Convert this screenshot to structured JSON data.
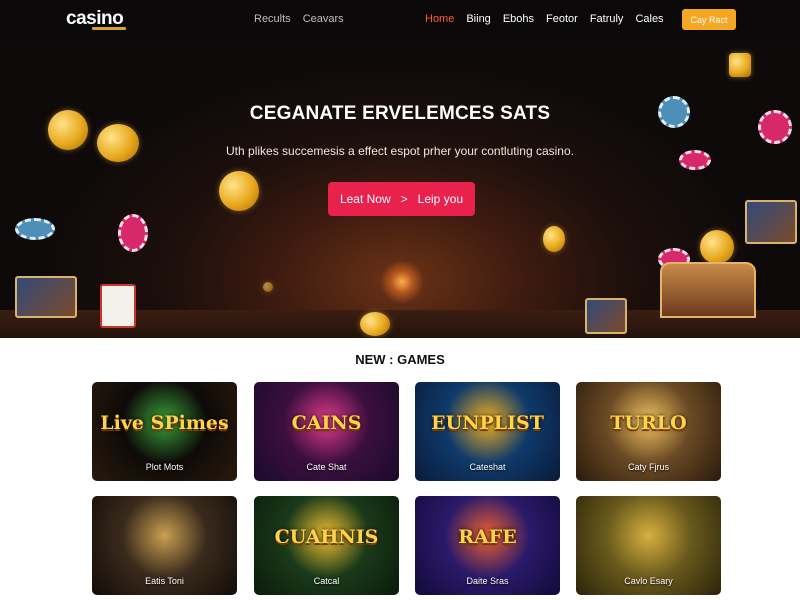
{
  "header": {
    "logo": "casino",
    "nav_left": [
      "Recults",
      "Ceavars"
    ],
    "nav_right": [
      {
        "label": "Home",
        "active": true
      },
      {
        "label": "Biing",
        "active": false
      },
      {
        "label": "Ebohs",
        "active": false
      },
      {
        "label": "Feotor",
        "active": false
      },
      {
        "label": "Fatruly",
        "active": false
      },
      {
        "label": "Cales",
        "active": false
      }
    ],
    "cta": "Cay Ract"
  },
  "hero": {
    "title": "CEGANATE ERVELEMCES SATS",
    "subtitle": "Uth plikes succemesis a effect espot prher your contluting casino.",
    "button_left": "Leat Now",
    "button_chevron": ">",
    "button_right": "Leip you"
  },
  "games": {
    "title": "NEW : GAMES",
    "tiles": [
      {
        "art": "Live SPimes",
        "label": "Plot Mots",
        "bg": [
          "#0e0a08",
          "#2a1a0c"
        ],
        "accent": "#3aa13a"
      },
      {
        "art": "CAINS",
        "label": "Cate Shat",
        "bg": [
          "#3b0f3f",
          "#1a0a2a"
        ],
        "accent": "#e23a8a"
      },
      {
        "art": "EUNPLIST",
        "label": "Cateshat",
        "bg": [
          "#0f3a6a",
          "#0a1a3a"
        ],
        "accent": "#f0b020"
      },
      {
        "art": "TURLO",
        "label": "Caty Fjrus",
        "bg": [
          "#6a4a24",
          "#2a1a0c"
        ],
        "accent": "#f0c060"
      },
      {
        "art": "",
        "label": "Eatis Toni",
        "bg": [
          "#3a2a1c",
          "#120c08"
        ],
        "accent": "#c8a050"
      },
      {
        "art": "CUAHNIS",
        "label": "Catcal",
        "bg": [
          "#1a3a1a",
          "#0a1a0a"
        ],
        "accent": "#f0c030"
      },
      {
        "art": "RAFE",
        "label": "Daite Sras",
        "bg": [
          "#2a1a6a",
          "#120a3a"
        ],
        "accent": "#f06030"
      },
      {
        "art": "",
        "label": "Cavlo Esary",
        "bg": [
          "#6a5a1c",
          "#2a240a"
        ],
        "accent": "#d8b040"
      }
    ]
  }
}
